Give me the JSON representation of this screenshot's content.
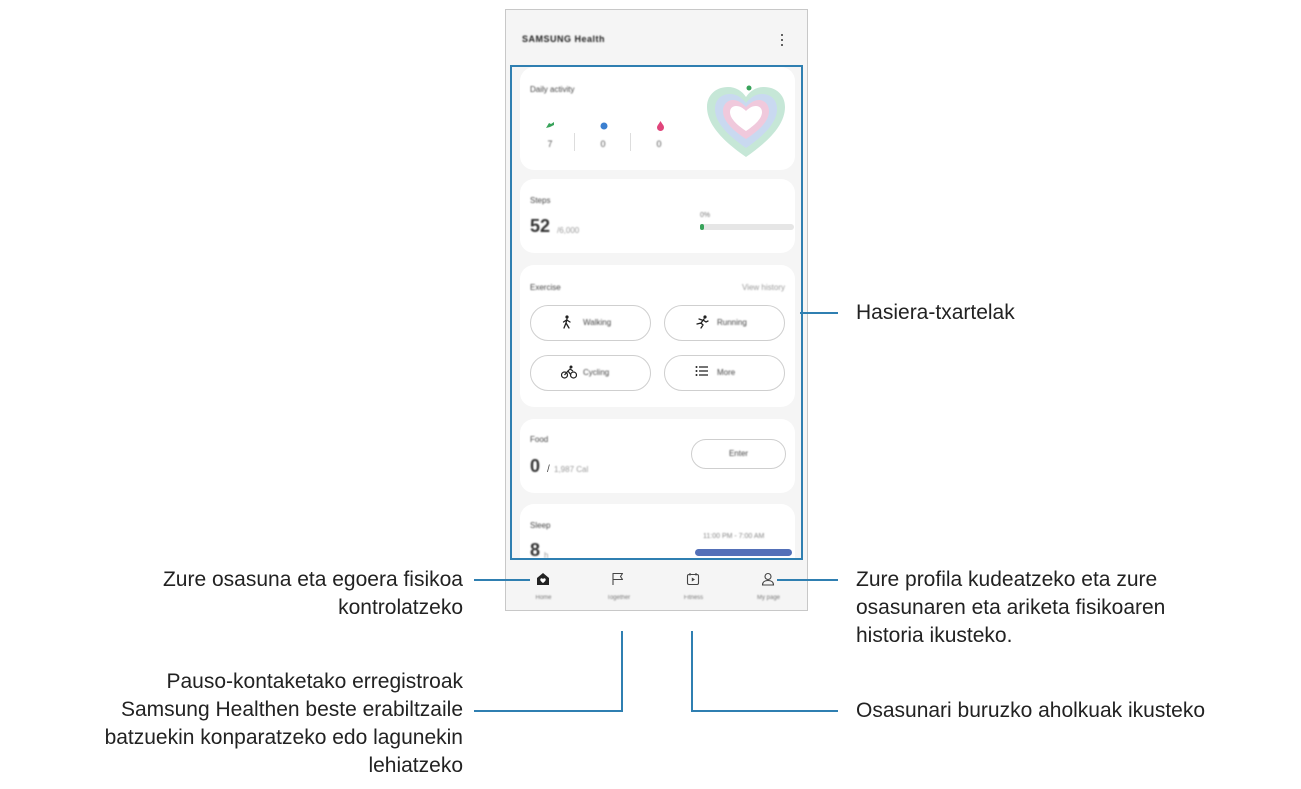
{
  "app": {
    "title": "SAMSUNG Health"
  },
  "daily_activity": {
    "title": "Daily activity",
    "values": [
      "7",
      "0",
      "0"
    ]
  },
  "steps": {
    "title": "Steps",
    "count": "52",
    "goal": "/6,000",
    "percent_label": "0%",
    "progress": 0.01
  },
  "exercise": {
    "title": "Exercise",
    "history_link": "View history",
    "buttons": [
      "Walking",
      "Running",
      "Cycling",
      "More"
    ]
  },
  "food": {
    "title": "Food",
    "value": "0",
    "slash": "/",
    "goal": "1,987 Cal",
    "button": "Enter"
  },
  "sleep": {
    "title": "Sleep",
    "value": "8",
    "unit": "h",
    "range": "11:00 PM - 7:00 AM"
  },
  "nav": {
    "items": [
      "Home",
      "Together",
      "Fitness",
      "My page"
    ]
  },
  "callouts": {
    "home_cards": "Hasiera-txartelak",
    "home_line1": "Zure osasuna eta egoera fisikoa",
    "home_line2": "kontrolatzeko",
    "together_line1": "Pauso-kontaketako erregistroak",
    "together_line2": "Samsung Healthen beste erabiltzaile",
    "together_line3": "batzuekin konparatzeko edo lagunekin",
    "together_line4": "lehiatzeko",
    "profile_line1": "Zure profila kudeatzeko eta zure",
    "profile_line2": "osasunaren eta ariketa fisikoaren",
    "profile_line3": "historia ikusteko.",
    "fitness": "Osasunari buruzko aholkuak ikusteko"
  },
  "colors": {
    "callout_line": "#2f7fb1",
    "steps_green": "#38a35a",
    "sleep_blue": "#5370b8"
  }
}
